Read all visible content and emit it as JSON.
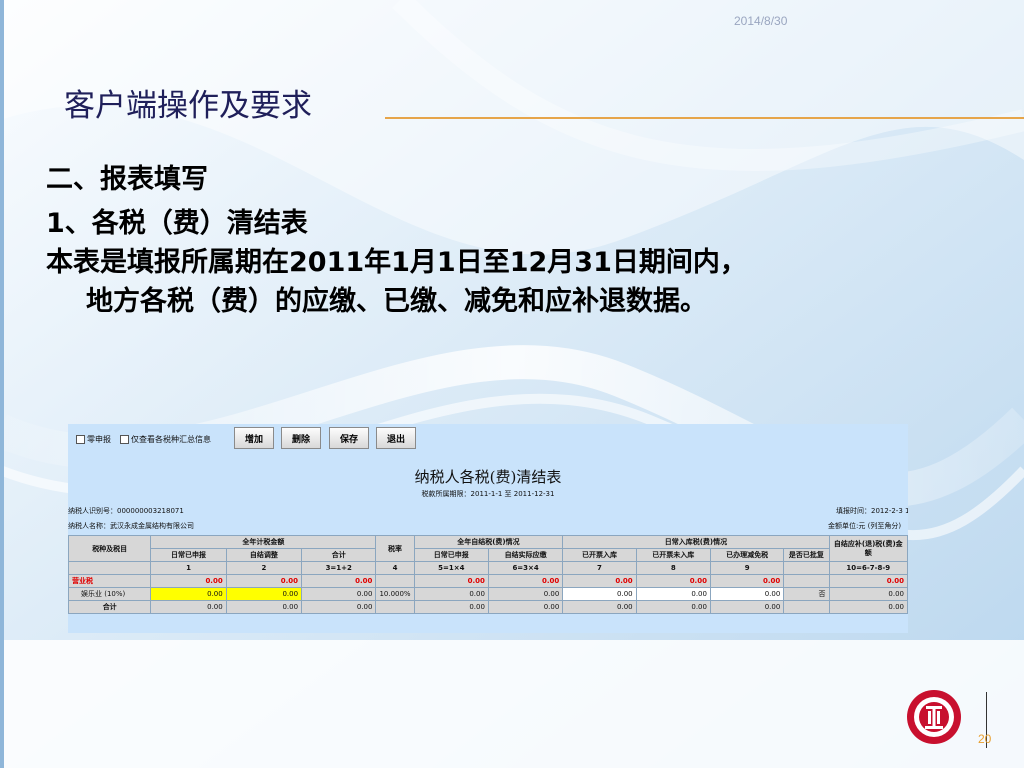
{
  "slide": {
    "date": "2014/8/30",
    "title": "客户端操作及要求",
    "page_number": "20",
    "bullets": [
      "二、报表填写",
      "1、各税（费）清结表",
      "本表是填报所属期在2011年1月1日至12月31日期间内，",
      "地方各税（费）的应缴、已缴、减免和应补退数据。"
    ]
  },
  "form": {
    "checkbox_zero": "零申报",
    "checkbox_summary": "仅查看各税种汇总信息",
    "buttons": [
      "增加",
      "删除",
      "保存",
      "退出"
    ],
    "title": "纳税人各税(费)清结表",
    "period": "税款所属期限：2011-1-1 至 2011-12-31",
    "taxpayer_id": "纳税人识别号：000000003218071",
    "taxpayer_name": "纳税人名称：武汉永成金属结构有限公司",
    "fill_date": "填报时间：2012-2-3 1",
    "unit": "金额单位:元 (列至角分)",
    "headers": {
      "tax_type": "税种及税目",
      "annual_group": "全年计税金额",
      "daily_reported": "日常已申报",
      "settle_adjust": "自结调整",
      "total": "合计",
      "rate": "税率",
      "settle_group": "全年自结税(费)情况",
      "settle_reported": "日常已申报",
      "settle_actual": "自结实际应缴",
      "storage_group": "日常入库税(费)情况",
      "invoiced_in": "已开票入库",
      "invoiced_not_in": "已开票未入库",
      "reduced": "已办理减免税",
      "audited": "是否已批复",
      "refund": "自结应补(退)税(费)金额"
    },
    "col_numbers": [
      "1",
      "2",
      "3=1+2",
      "4",
      "5=1×4",
      "6=3×4",
      "7",
      "8",
      "9",
      "",
      "10=6-7-8-9"
    ],
    "rows": [
      {
        "name": "营业税",
        "c1": "0.00",
        "c2": "0.00",
        "c3": "0.00",
        "rate": "",
        "c5": "0.00",
        "c6": "0.00",
        "c7": "0.00",
        "c8": "0.00",
        "c9": "0.00",
        "appr": "",
        "c10": "0.00"
      },
      {
        "name": "娱乐业 (10%)",
        "c1": "0.00",
        "c2": "0.00",
        "c3": "0.00",
        "rate": "10.000%",
        "c5": "0.00",
        "c6": "0.00",
        "c7": "0.00",
        "c8": "0.00",
        "c9": "0.00",
        "appr": "否",
        "c10": "0.00"
      },
      {
        "name": "合计",
        "c1": "0.00",
        "c2": "0.00",
        "c3": "0.00",
        "rate": "",
        "c5": "0.00",
        "c6": "0.00",
        "c7": "0.00",
        "c8": "0.00",
        "c9": "0.00",
        "appr": "",
        "c10": "0.00"
      }
    ]
  },
  "colors": {
    "title": "#1f1f5a",
    "accent_rule": "#e6a54a",
    "page_number": "#e8a030",
    "logo_red": "#c8102e"
  },
  "icons": {
    "logo": "tax-bureau-emblem-icon"
  }
}
